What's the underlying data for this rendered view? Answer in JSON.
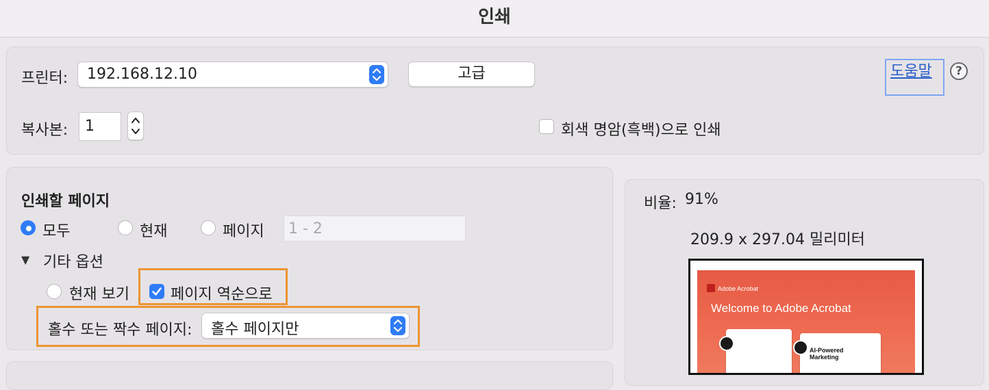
{
  "window": {
    "title": "인쇄"
  },
  "printer": {
    "label": "프린터:",
    "value": "192.168.12.10",
    "advanced_button": "고급",
    "help_link": "도움말",
    "help_icon_glyph": "?"
  },
  "copies": {
    "label": "복사본:",
    "value": "1",
    "grayscale_label": "회색 명암(흑백)으로 인쇄",
    "grayscale_checked": false
  },
  "pages": {
    "heading": "인쇄할 페이지",
    "options": [
      {
        "label": "모두",
        "selected": true
      },
      {
        "label": "현재",
        "selected": false
      },
      {
        "label": "페이지",
        "selected": false
      }
    ],
    "range_value": "1 - 2",
    "more_options": {
      "toggle_label": "기타 옵션",
      "toggle_glyph": "▼",
      "current_view_label": "현재 보기",
      "reverse_label": "페이지 역순으로",
      "reverse_checked": true,
      "odd_even_label": "홀수 또는 짝수 페이지:",
      "odd_even_value": "홀수 페이지만"
    }
  },
  "preview": {
    "scale_label": "비율:",
    "scale_value": "91%",
    "size_text": "209.9 x 297.04 밀리미터",
    "doc_brand": "Adobe Acrobat",
    "doc_heading": "Welcome to Adobe Acrobat",
    "thumb_text": "AI-Powered Marketing"
  },
  "colors": {
    "accent": "#2f7cf6",
    "highlight": "#ec9432",
    "link": "#2a5fc9"
  }
}
